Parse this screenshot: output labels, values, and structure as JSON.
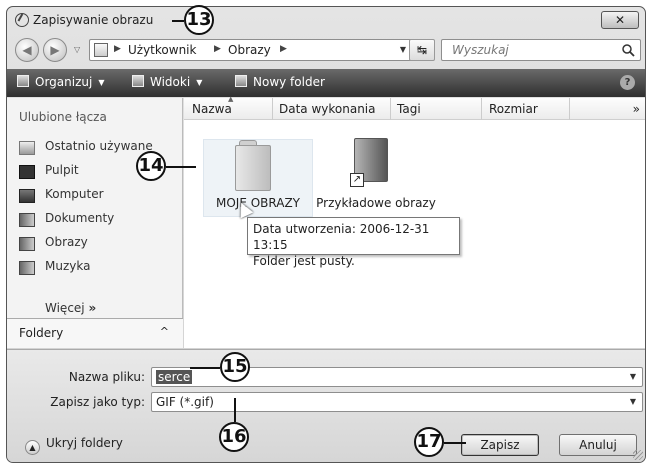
{
  "window": {
    "title": "Zapisywanie obrazu",
    "close_label": "✕"
  },
  "address_bar": {
    "crumbs": [
      "Użytkownik",
      "Obrazy"
    ],
    "search_placeholder": "Wyszukaj"
  },
  "toolbar": {
    "organize": "Organizuj",
    "views": "Widoki",
    "new_folder": "Nowy folder",
    "help": "?"
  },
  "nav_pane": {
    "header": "Ulubione łącza",
    "items": [
      {
        "label": "Ostatnio używane",
        "icon": "recent-icon"
      },
      {
        "label": "Pulpit",
        "icon": "desktop-icon"
      },
      {
        "label": "Komputer",
        "icon": "computer-icon"
      },
      {
        "label": "Dokumenty",
        "icon": "documents-icon"
      },
      {
        "label": "Obrazy",
        "icon": "pictures-icon"
      },
      {
        "label": "Muzyka",
        "icon": "music-icon"
      }
    ],
    "more": "Więcej",
    "more_chevron": "»",
    "folders": "Foldery",
    "folders_caret": "^"
  },
  "file_list": {
    "columns": [
      "Nazwa",
      "Data wykonania",
      "Tagi",
      "Rozmiar"
    ],
    "more_columns": "»",
    "items": [
      {
        "name": "MOJE OBRAZY",
        "icon": "folder-icon"
      },
      {
        "name": "Przykładowe obrazy",
        "icon": "shortcut-folder-icon"
      }
    ],
    "tooltip": {
      "line1": "Data utworzenia: 2006-12-31 13:15",
      "line2": "Folder jest pusty."
    }
  },
  "save_pane": {
    "filename_label": "Nazwa pliku:",
    "filename_value": "serce",
    "type_label": "Zapisz jako typ:",
    "type_value": "GIF (*.gif)",
    "hide_folders": "Ukryj foldery",
    "save_button": "Zapisz",
    "cancel_button": "Anuluj"
  },
  "callouts": {
    "c13": "13",
    "c14": "14",
    "c15": "15",
    "c16": "16",
    "c17": "17"
  }
}
